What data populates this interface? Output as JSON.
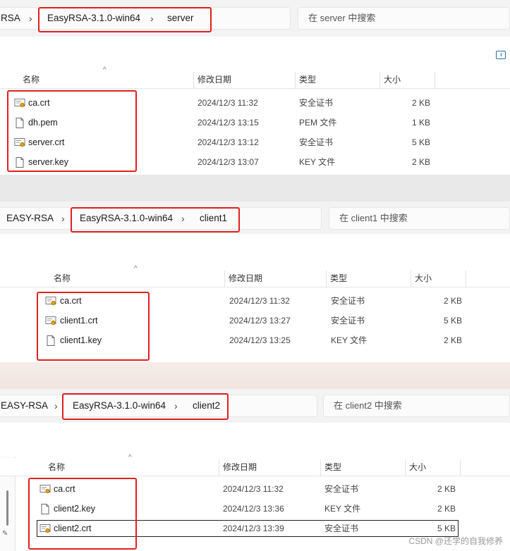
{
  "panels": [
    {
      "breadcrumb": [
        "RSA",
        "EasyRSA-3.1.0-win64",
        "server"
      ],
      "search_placeholder": "在 server 中搜索",
      "columns": {
        "name": "名称",
        "date": "修改日期",
        "type": "类型",
        "size": "大小"
      },
      "files": [
        {
          "name": "ca.crt",
          "icon": "certificate-icon",
          "date": "2024/12/3 11:32",
          "type": "安全证书",
          "size": "2 KB"
        },
        {
          "name": "dh.pem",
          "icon": "document-icon",
          "date": "2024/12/3 13:15",
          "type": "PEM 文件",
          "size": "1 KB"
        },
        {
          "name": "server.crt",
          "icon": "certificate-icon",
          "date": "2024/12/3 13:12",
          "type": "安全证书",
          "size": "5 KB"
        },
        {
          "name": "server.key",
          "icon": "document-icon",
          "date": "2024/12/3 13:07",
          "type": "KEY 文件",
          "size": "2 KB"
        }
      ]
    },
    {
      "breadcrumb": [
        "EASY-RSA",
        "EasyRSA-3.1.0-win64",
        "client1"
      ],
      "search_placeholder": "在 client1 中搜索",
      "columns": {
        "name": "名称",
        "date": "修改日期",
        "type": "类型",
        "size": "大小"
      },
      "files": [
        {
          "name": "ca.crt",
          "icon": "certificate-icon",
          "date": "2024/12/3 11:32",
          "type": "安全证书",
          "size": "2 KB"
        },
        {
          "name": "client1.crt",
          "icon": "certificate-icon",
          "date": "2024/12/3 13:27",
          "type": "安全证书",
          "size": "5 KB"
        },
        {
          "name": "client1.key",
          "icon": "document-icon",
          "date": "2024/12/3 13:25",
          "type": "KEY 文件",
          "size": "2 KB"
        }
      ]
    },
    {
      "breadcrumb": [
        "EASY-RSA",
        "EasyRSA-3.1.0-win64",
        "client2"
      ],
      "search_placeholder": "在 client2 中搜索",
      "columns": {
        "name": "名称",
        "date": "修改日期",
        "type": "类型",
        "size": "大小"
      },
      "files": [
        {
          "name": "ca.crt",
          "icon": "certificate-icon",
          "date": "2024/12/3 11:32",
          "type": "安全证书",
          "size": "2 KB"
        },
        {
          "name": "client2.key",
          "icon": "document-icon",
          "date": "2024/12/3 13:36",
          "type": "KEY 文件",
          "size": "2 KB"
        },
        {
          "name": "client2.crt",
          "icon": "certificate-icon",
          "date": "2024/12/3 13:39",
          "type": "安全证书",
          "size": "5 KB"
        }
      ]
    }
  ],
  "watermark": "CSDN @还学的自我修养",
  "colors": {
    "highlight": "#e02020",
    "accent": "#2a6db0"
  }
}
